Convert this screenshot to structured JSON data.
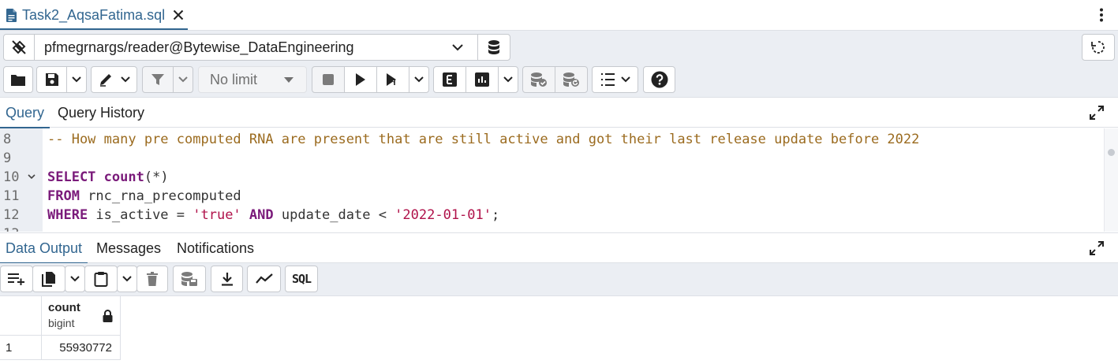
{
  "tab": {
    "title": "Task2_AqsaFatima.sql",
    "icons": [
      "file-icon",
      "close-icon"
    ]
  },
  "menu": {
    "icon": "kebab-menu-icon"
  },
  "connection": {
    "name": "pfmegrnargs/reader@Bytewise_DataEngineering",
    "icons": [
      "connection-status-icon",
      "chevron-down-icon",
      "database-icon",
      "reset-layout-icon"
    ]
  },
  "toolbar": {
    "limit_label": "No limit",
    "icons": [
      "folder-open-icon",
      "save-icon",
      "edit-pencil-icon",
      "filter-icon",
      "stop-icon",
      "play-icon",
      "execute-script-icon",
      "explain-icon",
      "explain-analyze-icon",
      "commit-icon",
      "rollback-icon",
      "macros-icon",
      "help-icon"
    ]
  },
  "query_tabs": [
    "Query",
    "Query History"
  ],
  "editor": {
    "lines": [
      {
        "num": "8",
        "tokens": [
          {
            "t": "comment",
            "v": "-- How many pre computed RNA are present that are still active and got their last release update before 2022"
          }
        ]
      },
      {
        "num": "9",
        "tokens": []
      },
      {
        "num": "10",
        "fold": true,
        "tokens": [
          {
            "t": "kw",
            "v": "SELECT"
          },
          {
            "t": "plain",
            "v": " "
          },
          {
            "t": "kw",
            "v": "count"
          },
          {
            "t": "plain",
            "v": "(*)"
          }
        ]
      },
      {
        "num": "11",
        "tokens": [
          {
            "t": "kw",
            "v": "FROM"
          },
          {
            "t": "plain",
            "v": " rnc_rna_precomputed"
          }
        ]
      },
      {
        "num": "12",
        "tokens": [
          {
            "t": "kw",
            "v": "WHERE"
          },
          {
            "t": "plain",
            "v": " is_active = "
          },
          {
            "t": "str",
            "v": "'true'"
          },
          {
            "t": "plain",
            "v": " "
          },
          {
            "t": "kw",
            "v": "AND"
          },
          {
            "t": "plain",
            "v": " update_date < "
          },
          {
            "t": "str",
            "v": "'2022-01-01'"
          },
          {
            "t": "plain",
            "v": ";"
          }
        ]
      },
      {
        "num": "13",
        "tokens": []
      }
    ]
  },
  "output_tabs": [
    "Data Output",
    "Messages",
    "Notifications"
  ],
  "output_toolbar": {
    "icons": [
      "add-row-icon",
      "copy-icon",
      "paste-icon",
      "delete-icon",
      "save-data-icon",
      "download-icon",
      "graph-icon",
      "sql-icon"
    ],
    "sql_label": "SQL"
  },
  "result": {
    "columns": [
      {
        "name": "count",
        "type": "bigint"
      }
    ],
    "rows": [
      {
        "num": "1",
        "values": [
          "55930772"
        ]
      }
    ]
  },
  "colors": {
    "accent": "#326690",
    "toolbar_bg": "#ebeef3",
    "comment": "#9b6b1f",
    "keyword": "#7a1a7a",
    "string": "#b0124a"
  }
}
